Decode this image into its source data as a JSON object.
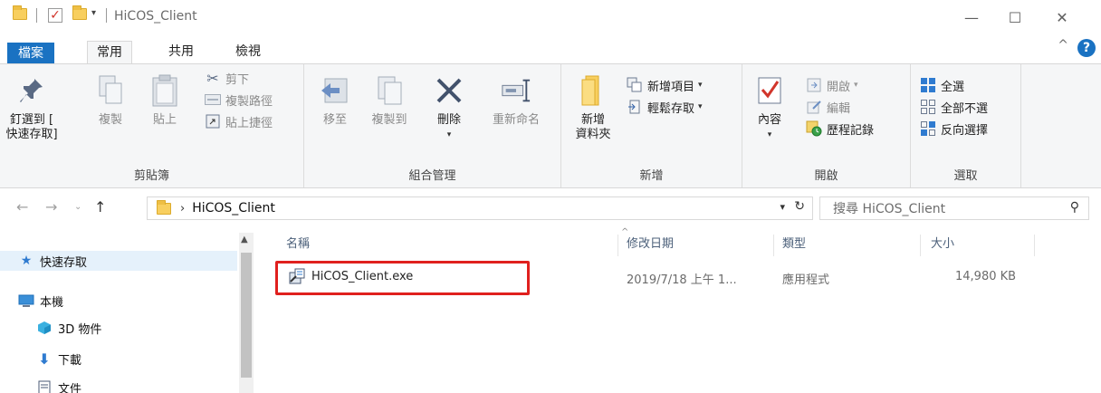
{
  "window": {
    "title": "HiCOS_Client",
    "minimize": "—",
    "maximize": "☐",
    "close": "✕"
  },
  "tabs": {
    "file": "檔案",
    "home": "常用",
    "share": "共用",
    "view": "檢視"
  },
  "ribbon": {
    "clipboard": {
      "label": "剪貼簿",
      "pin_line1": "釘選到 [",
      "pin_line2": "快速存取]",
      "copy": "複製",
      "paste": "貼上",
      "cut": "剪下",
      "copy_path": "複製路徑",
      "paste_shortcut": "貼上捷徑"
    },
    "organize": {
      "label": "組合管理",
      "move_to": "移至",
      "copy_to": "複製到",
      "delete": "刪除",
      "rename": "重新命名"
    },
    "new": {
      "label": "新增",
      "new_folder_line1": "新增",
      "new_folder_line2": "資料夾",
      "new_item": "新增項目",
      "easy_access": "輕鬆存取"
    },
    "open": {
      "label": "開啟",
      "properties": "內容",
      "open": "開啟",
      "edit": "編輯",
      "history": "歷程記錄"
    },
    "select": {
      "label": "選取",
      "select_all": "全選",
      "select_none": "全部不選",
      "invert": "反向選擇"
    }
  },
  "address": {
    "path": "HiCOS_Client",
    "search_placeholder": "搜尋 HiCOS_Client"
  },
  "navpane": {
    "items": [
      {
        "label": "快速存取"
      },
      {
        "label": "本機"
      },
      {
        "label": "3D 物件"
      },
      {
        "label": "下載"
      },
      {
        "label": "文件"
      }
    ]
  },
  "columns": {
    "name": "名稱",
    "date": "修改日期",
    "type": "類型",
    "size": "大小"
  },
  "files": [
    {
      "name": "HiCOS_Client.exe",
      "date": "2019/7/18 上午 1...",
      "type": "應用程式",
      "size": "14,980 KB"
    }
  ],
  "colors": {
    "accent": "#1a72c2",
    "highlight_box": "#e0201e"
  }
}
